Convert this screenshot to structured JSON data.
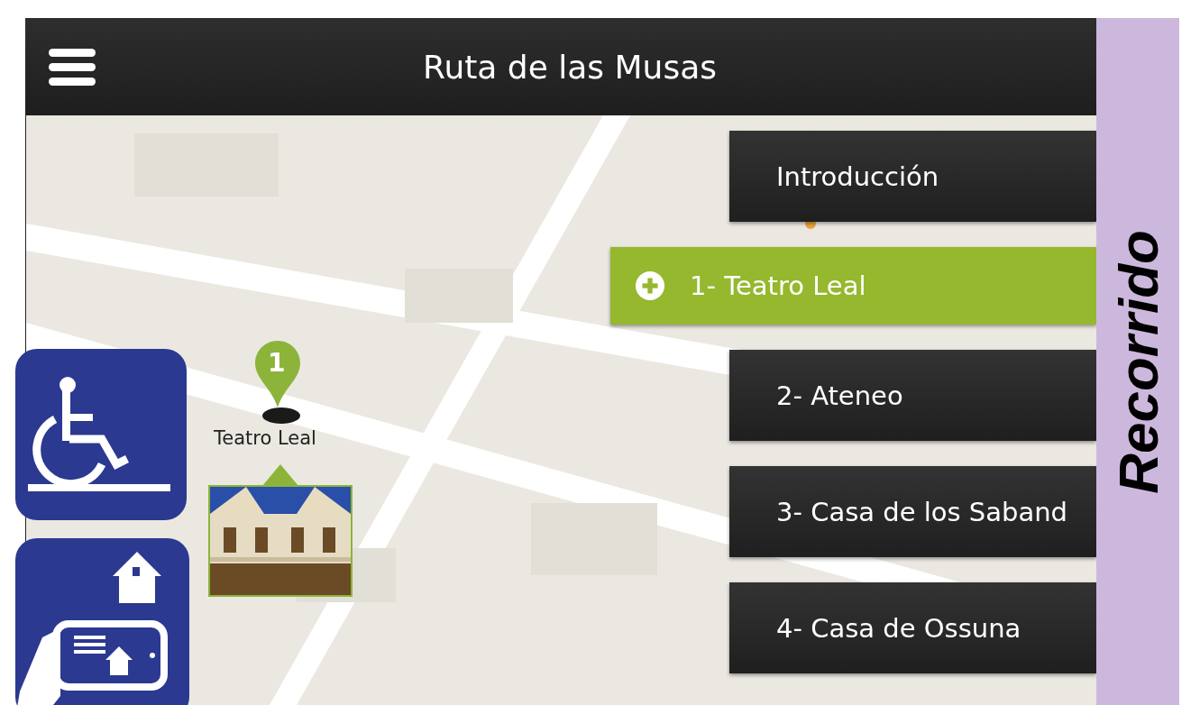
{
  "header": {
    "title": "Ruta de las Musas"
  },
  "map": {
    "kind": "picture",
    "marker": {
      "number": "1",
      "label": "Teatro Leal"
    }
  },
  "menu": [
    {
      "label": "Introducción",
      "selected": false
    },
    {
      "label": "1- Teatro Leal",
      "selected": true
    },
    {
      "label": "2- Ateneo",
      "selected": false
    },
    {
      "label": "3- Casa de los Saband",
      "selected": false
    },
    {
      "label": "4- Casa de Ossuna",
      "selected": false
    }
  ],
  "side_tab": {
    "label": "Recorrido"
  }
}
